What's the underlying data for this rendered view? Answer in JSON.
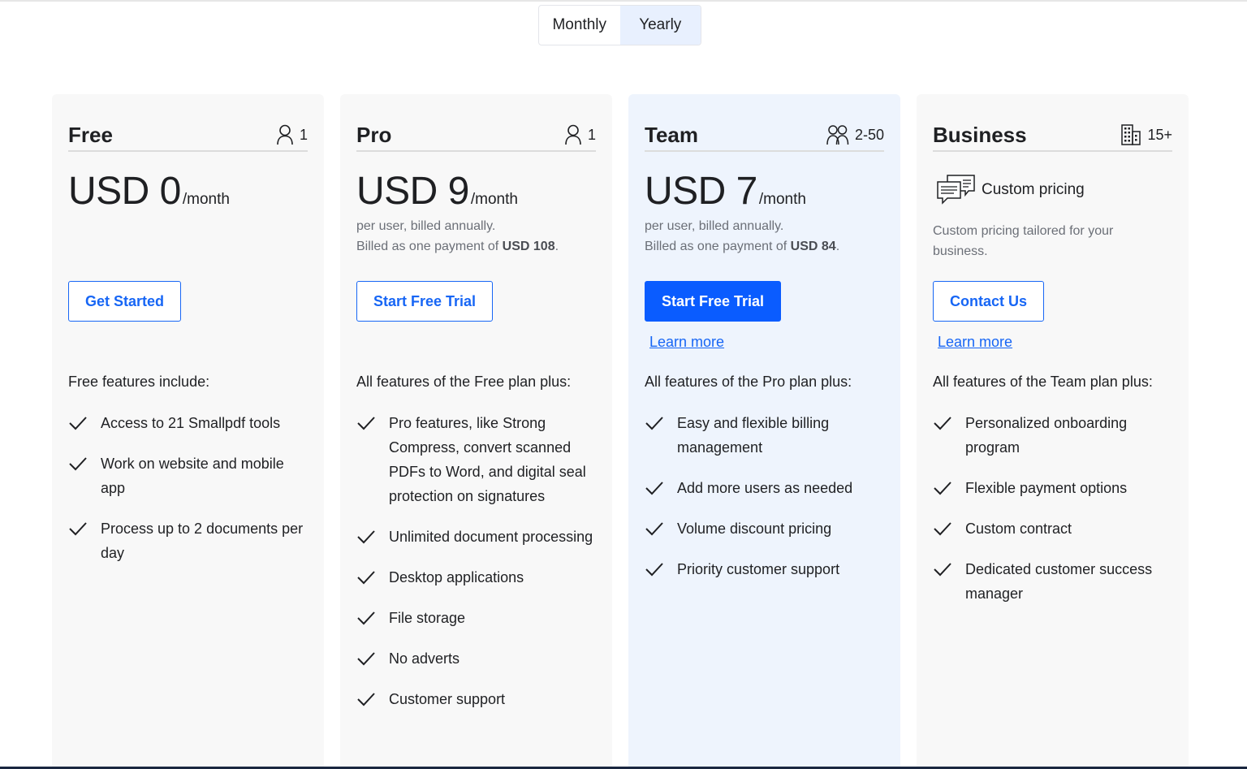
{
  "billing_toggle": {
    "options": [
      "Monthly",
      "Yearly"
    ],
    "selected": "Yearly"
  },
  "plans": [
    {
      "name": "Free",
      "users": "1",
      "price": "USD 0",
      "period": "/month",
      "cta": "Get Started",
      "features_intro": "Free features include:",
      "features": [
        "Access to 21 Smallpdf tools",
        "Work on website and mobile app",
        "Process up to 2 documents per day"
      ]
    },
    {
      "name": "Pro",
      "users": "1",
      "price": "USD 9",
      "period": "/month",
      "billing_line1": "per user, billed annually.",
      "billing_line2_prefix": "Billed as one payment of ",
      "billing_amount": "USD 108",
      "billing_suffix": ".",
      "cta": "Start Free Trial",
      "features_intro": "All features of the Free plan plus:",
      "features": [
        "Pro features, like Strong Compress, convert scanned PDFs to Word, and digital seal protection on signatures",
        "Unlimited document processing",
        "Desktop applications",
        "File storage",
        "No adverts",
        "Customer support"
      ]
    },
    {
      "name": "Team",
      "users": "2-50",
      "price": "USD 7",
      "period": "/month",
      "billing_line1": "per user, billed annually.",
      "billing_line2_prefix": "Billed as one payment of ",
      "billing_amount": "USD 84",
      "billing_suffix": ".",
      "cta": "Start Free Trial",
      "learn_more": "Learn more",
      "features_intro": "All features of the Pro plan plus:",
      "features": [
        "Easy and flexible billing management",
        "Add more users as needed",
        "Volume discount pricing",
        "Priority customer support"
      ]
    },
    {
      "name": "Business",
      "users": "15+",
      "custom_label": "Custom pricing",
      "custom_desc": "Custom pricing tailored for your business.",
      "cta": "Contact Us",
      "learn_more": "Learn more",
      "features_intro": "All features of the Team plan plus:",
      "features": [
        "Personalized onboarding program",
        "Flexible payment options",
        "Custom contract",
        "Dedicated customer success manager"
      ]
    }
  ],
  "colors": {
    "accent": "#0a5cff",
    "card_bg": "#f8f8f8",
    "highlight_card_bg": "#eef4fd",
    "toggle_active_bg": "#e8f0fe"
  },
  "icons": {
    "single_user": "user-icon",
    "team": "users-icon",
    "business": "building-icon",
    "custom_pricing": "chat-bubbles-icon",
    "feature": "checkmark-icon"
  }
}
